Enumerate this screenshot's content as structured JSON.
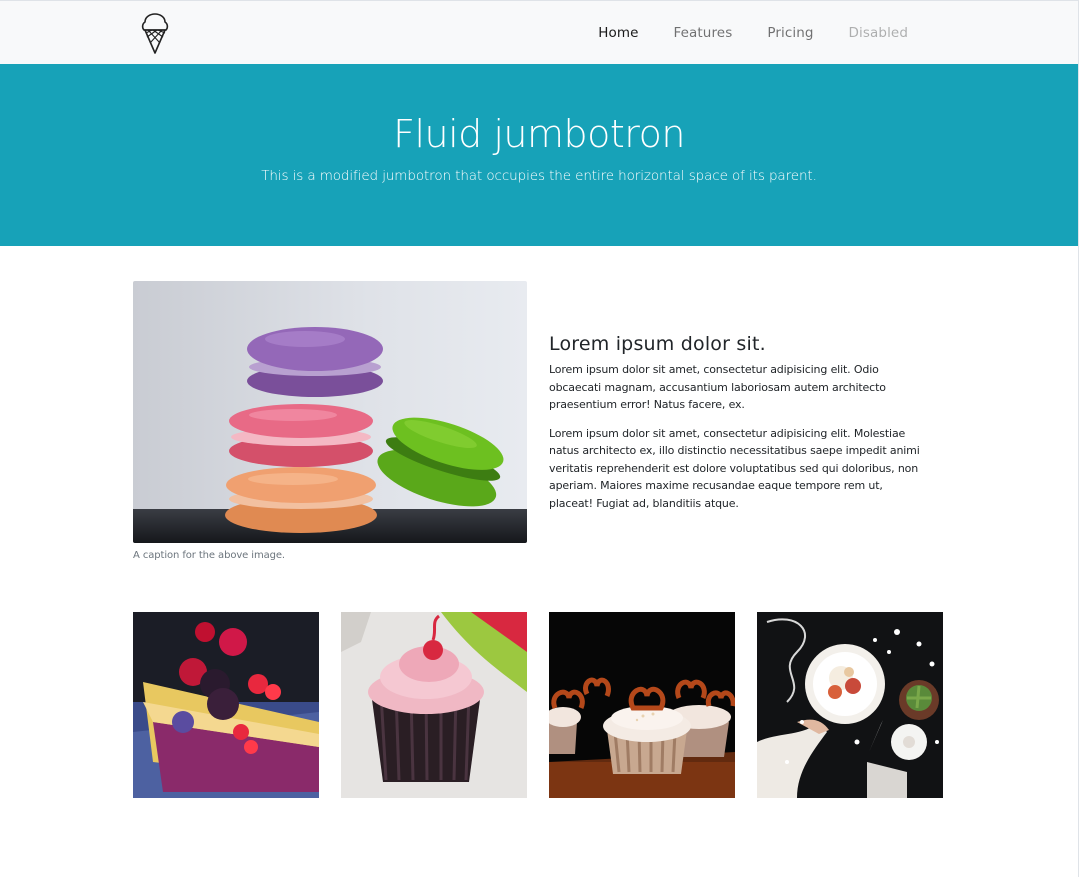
{
  "navbar": {
    "brand_icon": "ice-cream-cone-icon",
    "links": [
      {
        "label": "Home",
        "state": "active"
      },
      {
        "label": "Features",
        "state": "normal"
      },
      {
        "label": "Pricing",
        "state": "normal"
      },
      {
        "label": "Disabled",
        "state": "disabled"
      }
    ]
  },
  "jumbotron": {
    "title": "Fluid jumbotron",
    "lead": "This is a modified jumbotron that occupies the entire horizontal space of its parent.",
    "background_color": "#17a2b8"
  },
  "feature": {
    "image_subject": "stacked-macarons-image",
    "caption": "A caption for the above image.",
    "heading": "Lorem ipsum dolor sit.",
    "paragraphs": [
      "Lorem ipsum dolor sit amet, consectetur adipisicing elit. Odio obcaecati magnam, accusantium laboriosam autem architecto praesentium error! Natus facere, ex.",
      "Lorem ipsum dolor sit amet, consectetur adipisicing elit. Molestiae natus architecto ex, illo distinctio necessitatibus saepe impedit animi veritatis reprehenderit est dolore voluptatibus sed qui doloribus, non aperiam. Maiores maxime recusandae eaque tempore rem ut, placeat! Fugiat ad, blanditiis atque."
    ]
  },
  "gallery": [
    {
      "subject": "berry-cake-slice-image"
    },
    {
      "subject": "pink-cupcake-image"
    },
    {
      "subject": "pretzel-cupcakes-image"
    },
    {
      "subject": "dessert-plate-flatlay-image"
    }
  ]
}
